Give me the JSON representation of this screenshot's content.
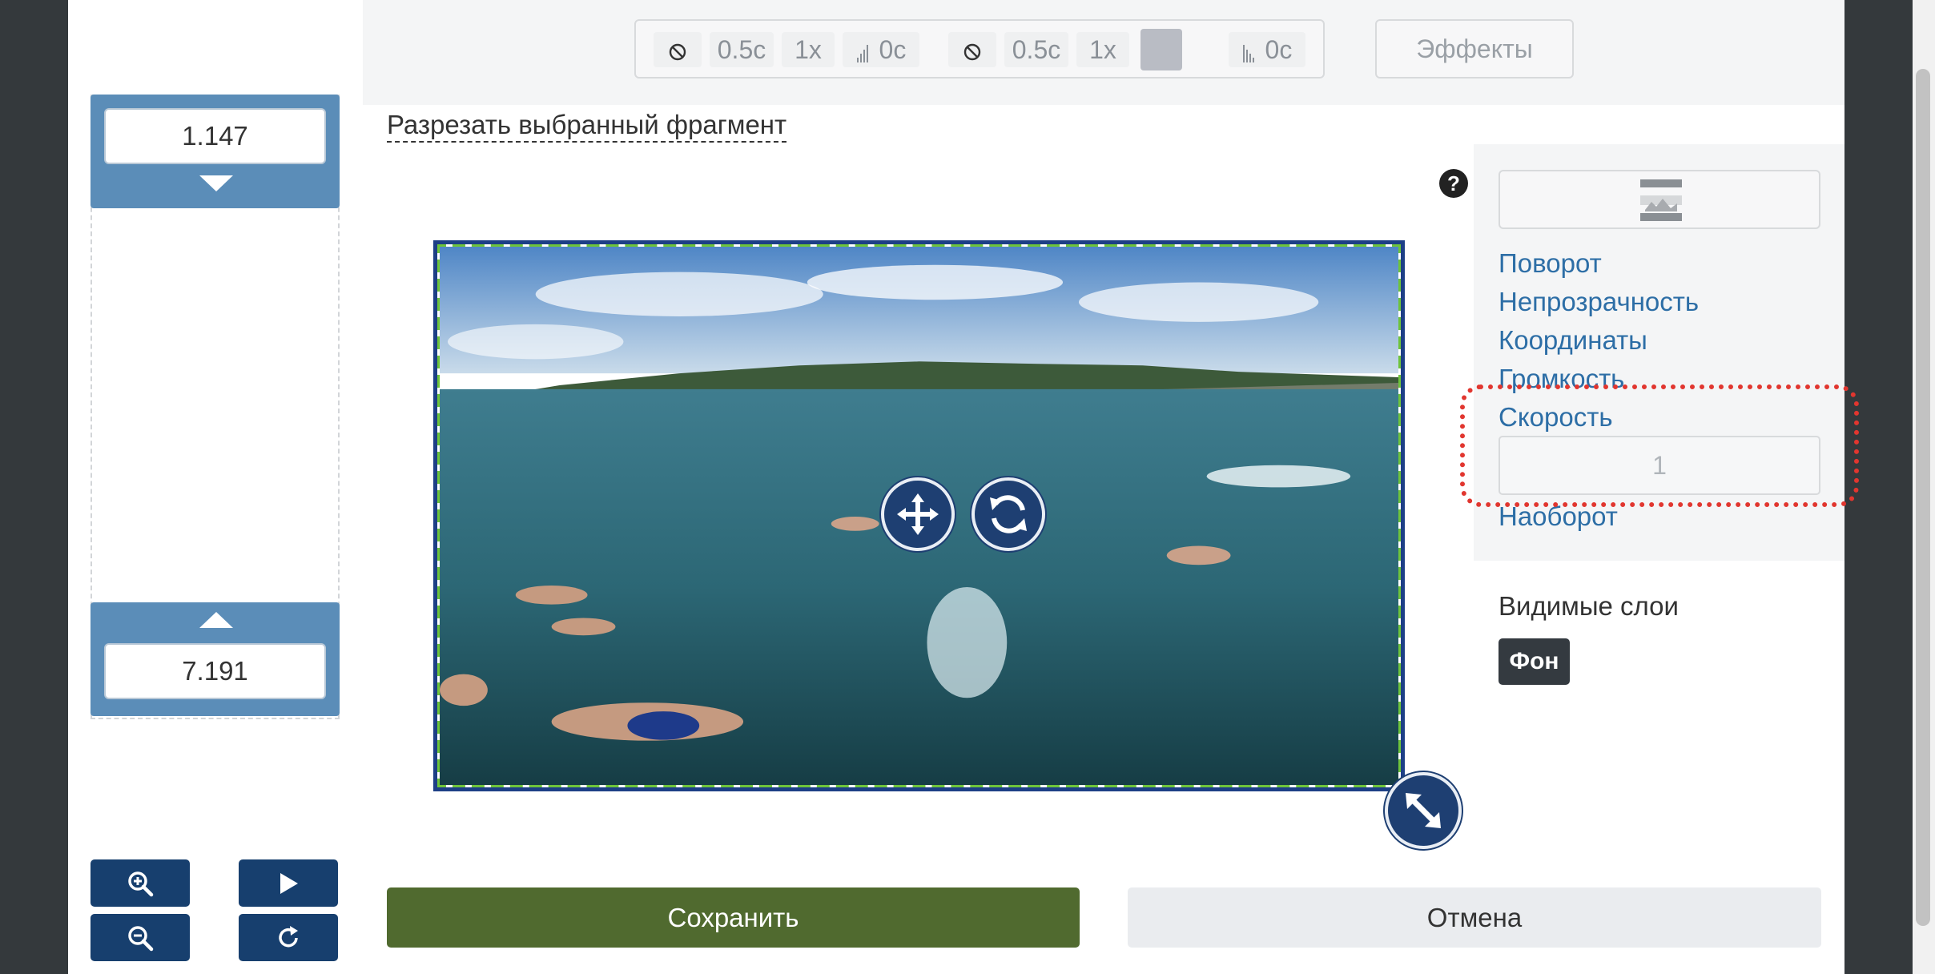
{
  "toolbar": {
    "track1": {
      "fade_in": "0.5c",
      "speed": "1x",
      "fade_out": "0c"
    },
    "track2": {
      "fade_in": "0.5c",
      "speed": "1x",
      "fade_out": "0c"
    },
    "effects_label": "Эффекты"
  },
  "cut_link": "Разрезать выбранный фрагмент",
  "timeline": {
    "start_value": "1.147",
    "end_value": "7.191"
  },
  "right_panel": {
    "links": [
      "Поворот",
      "Непрозрачность",
      "Координаты",
      "Громкость",
      "Скорость"
    ],
    "speed_value": "1",
    "flip_label": "Наоборот",
    "layers_title": "Видимые слои",
    "layer_chip": "Фон"
  },
  "actions": {
    "save": "Сохранить",
    "cancel": "Отмена"
  },
  "colors": {
    "save": "#506a2f",
    "highlight": "#e1362f",
    "link": "#2d6ea6",
    "nav": "#173f6e"
  }
}
